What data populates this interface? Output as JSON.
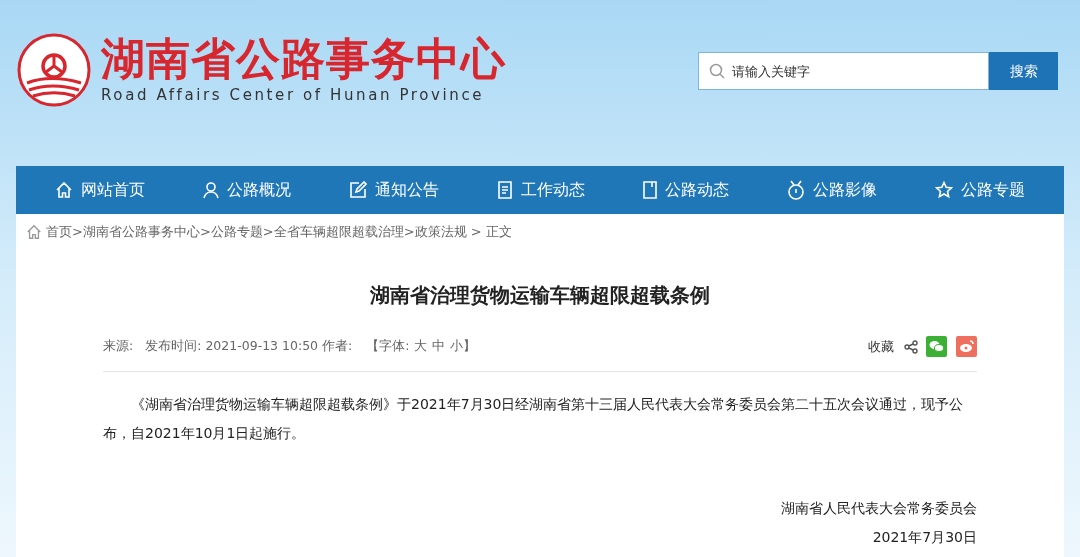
{
  "header": {
    "site_name": "湖南省公路事务中心",
    "site_name_en": "Road Affairs Center of Hunan Province",
    "search": {
      "placeholder": "请输入关键字",
      "button": "搜索"
    }
  },
  "nav": [
    {
      "label": "网站首页"
    },
    {
      "label": "公路概况"
    },
    {
      "label": "通知公告"
    },
    {
      "label": "工作动态"
    },
    {
      "label": "公路动态"
    },
    {
      "label": "公路影像"
    },
    {
      "label": "公路专题"
    }
  ],
  "breadcrumb": "首页>湖南省公路事务中心>公路专题>全省车辆超限超载治理>政策法规 > 正文",
  "article": {
    "title": "湖南省治理货物运输车辆超限超载条例",
    "meta": {
      "source": "来源:",
      "published": "发布时间: 2021-09-13 10:50",
      "author": "作者:",
      "font_open": "【字体:",
      "font_sizes": [
        "大",
        "中",
        "小"
      ],
      "font_close": "】"
    },
    "actions": {
      "favorite": "收藏"
    },
    "paragraphs": [
      "《湖南省治理货物运输车辆超限超载条例》于2021年7月30日经湖南省第十三届人民代表大会常务委员会第二十五次会议通过，现予公布，自2021年10月1日起施行。"
    ],
    "signature": [
      "湖南省人民代表大会常务委员会",
      "2021年7月30日"
    ]
  }
}
